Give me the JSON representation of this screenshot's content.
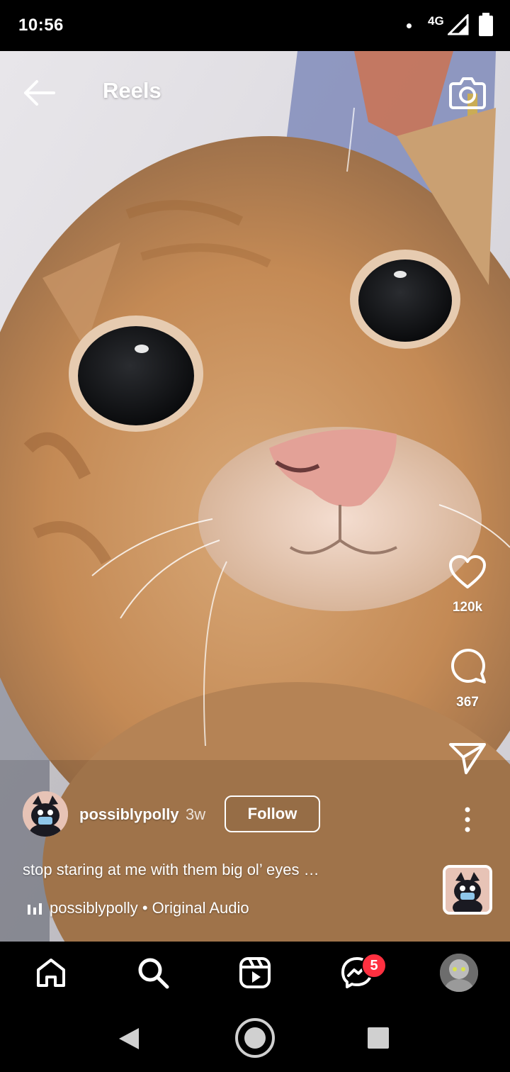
{
  "status_bar": {
    "time": "10:56",
    "network": "4G"
  },
  "header": {
    "title": "Reels",
    "back_icon": "arrow-left-icon",
    "camera_icon": "camera-icon"
  },
  "actions": {
    "likes": "120k",
    "comments": "367"
  },
  "post": {
    "author": "possiblypolly",
    "age": "3w",
    "follow_label": "Follow",
    "caption": "stop staring at me with them big ol’ eyes …",
    "audio": "possiblypolly • Original Audio"
  },
  "nav": {
    "messages_badge": "5",
    "items": [
      "home-icon",
      "search-icon",
      "reels-icon",
      "messenger-icon",
      "profile-avatar"
    ]
  },
  "colors": {
    "badge": "#ff3040",
    "background": "#000000",
    "text": "#ffffff"
  }
}
